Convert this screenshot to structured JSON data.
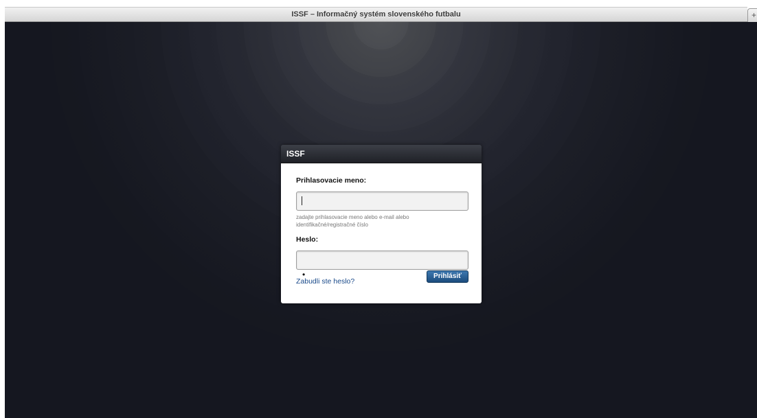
{
  "window": {
    "title": "ISSF – Informačný systém slovenského futbalu",
    "new_tab_label": "+"
  },
  "login": {
    "panel_title": "ISSF",
    "username_label": "Prihlasovacie meno:",
    "username_value": "",
    "username_hint": "zadajte prihlasovacie meno alebo e-mail alebo identifikačné/registračné číslo",
    "password_label": "Heslo:",
    "password_mask": "•",
    "submit_label": "Prihlásiť",
    "forgot_link": "Zabudli ste heslo?"
  }
}
